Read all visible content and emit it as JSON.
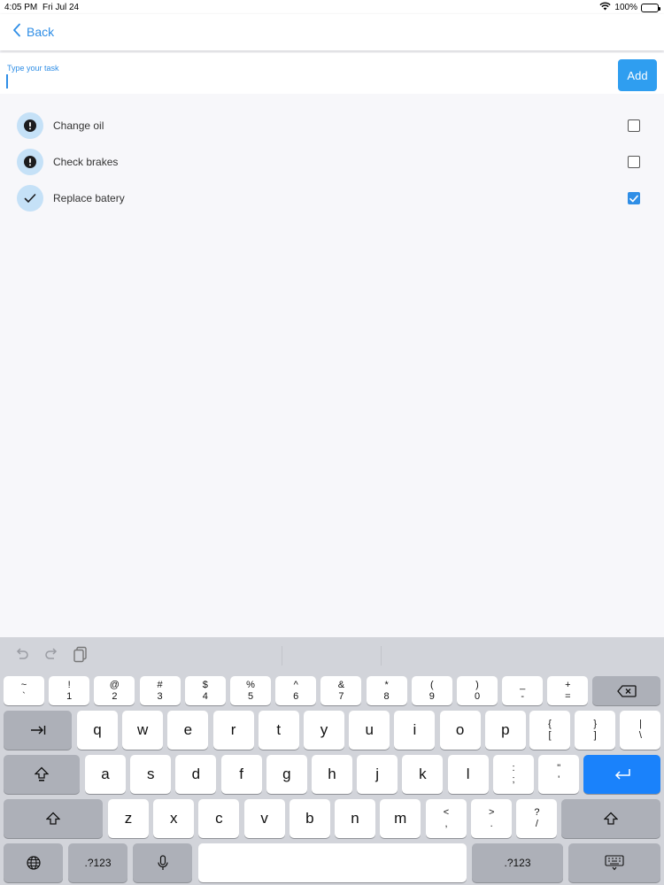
{
  "status_bar": {
    "time": "4:05 PM",
    "date": "Fri Jul 24",
    "battery": "100%"
  },
  "nav": {
    "back_label": "Back"
  },
  "task_input": {
    "label": "Type your task",
    "value": "",
    "placeholder": ""
  },
  "add_button": {
    "label": "Add"
  },
  "tasks": [
    {
      "label": "Change oil",
      "status_icon": "exclamation-icon",
      "checked": false
    },
    {
      "label": "Check brakes",
      "status_icon": "exclamation-icon",
      "checked": false
    },
    {
      "label": "Replace batery",
      "status_icon": "checkmark-icon",
      "checked": true
    }
  ],
  "colors": {
    "accent": "#2f8ee6",
    "add_button": "#2f9ef0",
    "avatar_bg": "#c5e1f7",
    "return_key": "#1a82fb"
  },
  "keyboard": {
    "number_row": [
      {
        "top": "~",
        "bottom": "`"
      },
      {
        "top": "!",
        "bottom": "1"
      },
      {
        "top": "@",
        "bottom": "2"
      },
      {
        "top": "#",
        "bottom": "3"
      },
      {
        "top": "$",
        "bottom": "4"
      },
      {
        "top": "%",
        "bottom": "5"
      },
      {
        "top": "^",
        "bottom": "6"
      },
      {
        "top": "&",
        "bottom": "7"
      },
      {
        "top": "*",
        "bottom": "8"
      },
      {
        "top": "(",
        "bottom": "9"
      },
      {
        "top": ")",
        "bottom": "0"
      },
      {
        "top": "_",
        "bottom": "-"
      },
      {
        "top": "+",
        "bottom": "="
      }
    ],
    "row_q": [
      "q",
      "w",
      "e",
      "r",
      "t",
      "y",
      "u",
      "i",
      "o",
      "p"
    ],
    "row_q_symbols": [
      {
        "top": "{",
        "bottom": "["
      },
      {
        "top": "}",
        "bottom": "]"
      },
      {
        "top": "|",
        "bottom": "\\"
      }
    ],
    "row_a": [
      "a",
      "s",
      "d",
      "f",
      "g",
      "h",
      "j",
      "k",
      "l"
    ],
    "row_a_symbols": [
      {
        "top": ":",
        "bottom": ";"
      },
      {
        "top": "\"",
        "bottom": "'"
      }
    ],
    "row_z": [
      "z",
      "x",
      "c",
      "v",
      "b",
      "n",
      "m"
    ],
    "row_z_symbols": [
      {
        "top": "<",
        "bottom": ","
      },
      {
        "top": ">",
        "bottom": "."
      },
      {
        "top": "?",
        "bottom": "/"
      }
    ],
    "numbers_key": ".?123"
  }
}
